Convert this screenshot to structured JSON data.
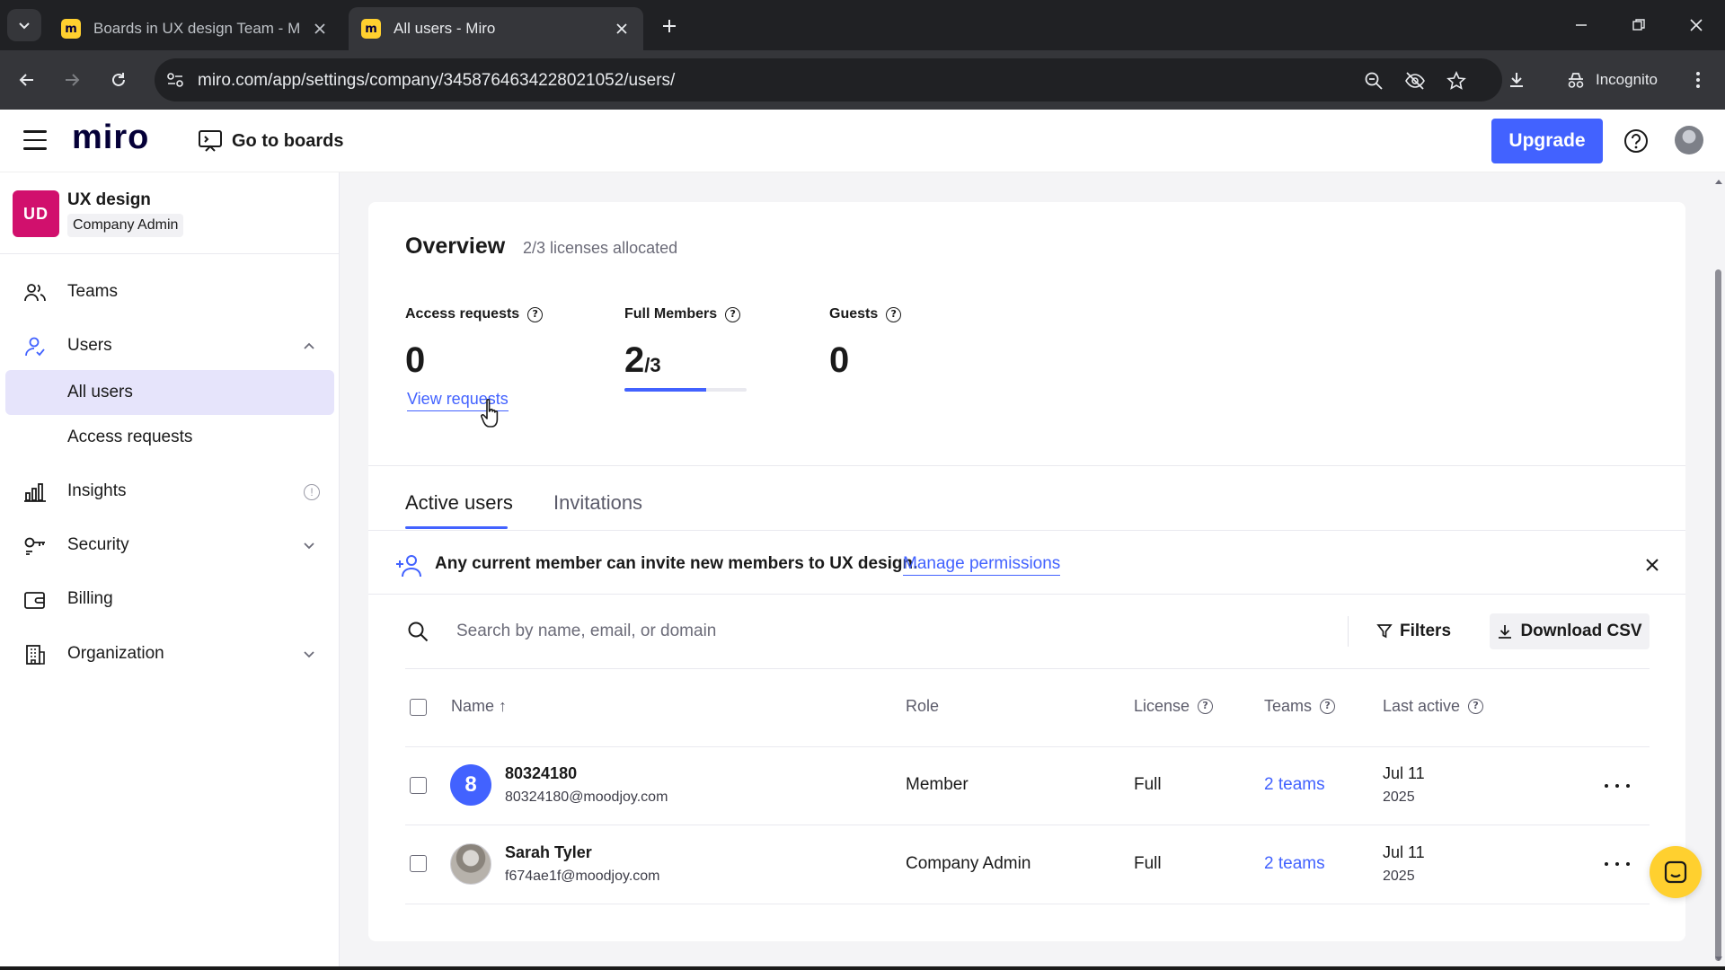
{
  "browser": {
    "tabs": [
      {
        "title": "Boards in UX design Team - Mir",
        "active": false
      },
      {
        "title": "All users - Miro",
        "active": true
      }
    ],
    "url": "miro.com/app/settings/company/3458764634228021052/users/",
    "incognito_label": "Incognito"
  },
  "header": {
    "logo": "miro",
    "go_to_boards": "Go to boards",
    "upgrade": "Upgrade"
  },
  "sidebar": {
    "org_initials": "UD",
    "org_name": "UX design",
    "org_role": "Company Admin",
    "items": [
      {
        "label": "Teams"
      },
      {
        "label": "Users"
      },
      {
        "label": "All users"
      },
      {
        "label": "Access requests"
      },
      {
        "label": "Insights"
      },
      {
        "label": "Security"
      },
      {
        "label": "Billing"
      },
      {
        "label": "Organization"
      }
    ]
  },
  "overview": {
    "title": "Overview",
    "subtitle": "2/3 licenses allocated",
    "access_requests": {
      "label": "Access requests",
      "value": "0",
      "link": "View requests"
    },
    "full_members": {
      "label": "Full Members",
      "value": "2",
      "total": "/3",
      "progress": 0.67
    },
    "guests": {
      "label": "Guests",
      "value": "0"
    }
  },
  "tabs": {
    "active_users": "Active users",
    "invitations": "Invitations"
  },
  "notice": {
    "text": "Any current member can invite new members to UX design.",
    "link": "Manage permissions"
  },
  "search": {
    "placeholder": "Search by name, email, or domain"
  },
  "actions": {
    "filters": "Filters",
    "download_csv": "Download CSV"
  },
  "table": {
    "columns": {
      "name": "Name ↑",
      "role": "Role",
      "license": "License",
      "teams": "Teams",
      "last_active": "Last active"
    },
    "rows": [
      {
        "avatar": "8",
        "name": "80324180",
        "email": "80324180@moodjoy.com",
        "role": "Member",
        "license": "Full",
        "teams": "2 teams",
        "last_active_date": "Jul 11",
        "last_active_year": "2025"
      },
      {
        "avatar": "",
        "name": "Sarah Tyler",
        "email": "f674ae1f@moodjoy.com",
        "role": "Company Admin",
        "license": "Full",
        "teams": "2 teams",
        "last_active_date": "Jul 11",
        "last_active_year": "2025"
      }
    ]
  },
  "colors": {
    "accent": "#4262ff",
    "org_badge": "#d1106d",
    "chat_button": "#ffd02f",
    "selected_nav": "#e6e4fb"
  }
}
